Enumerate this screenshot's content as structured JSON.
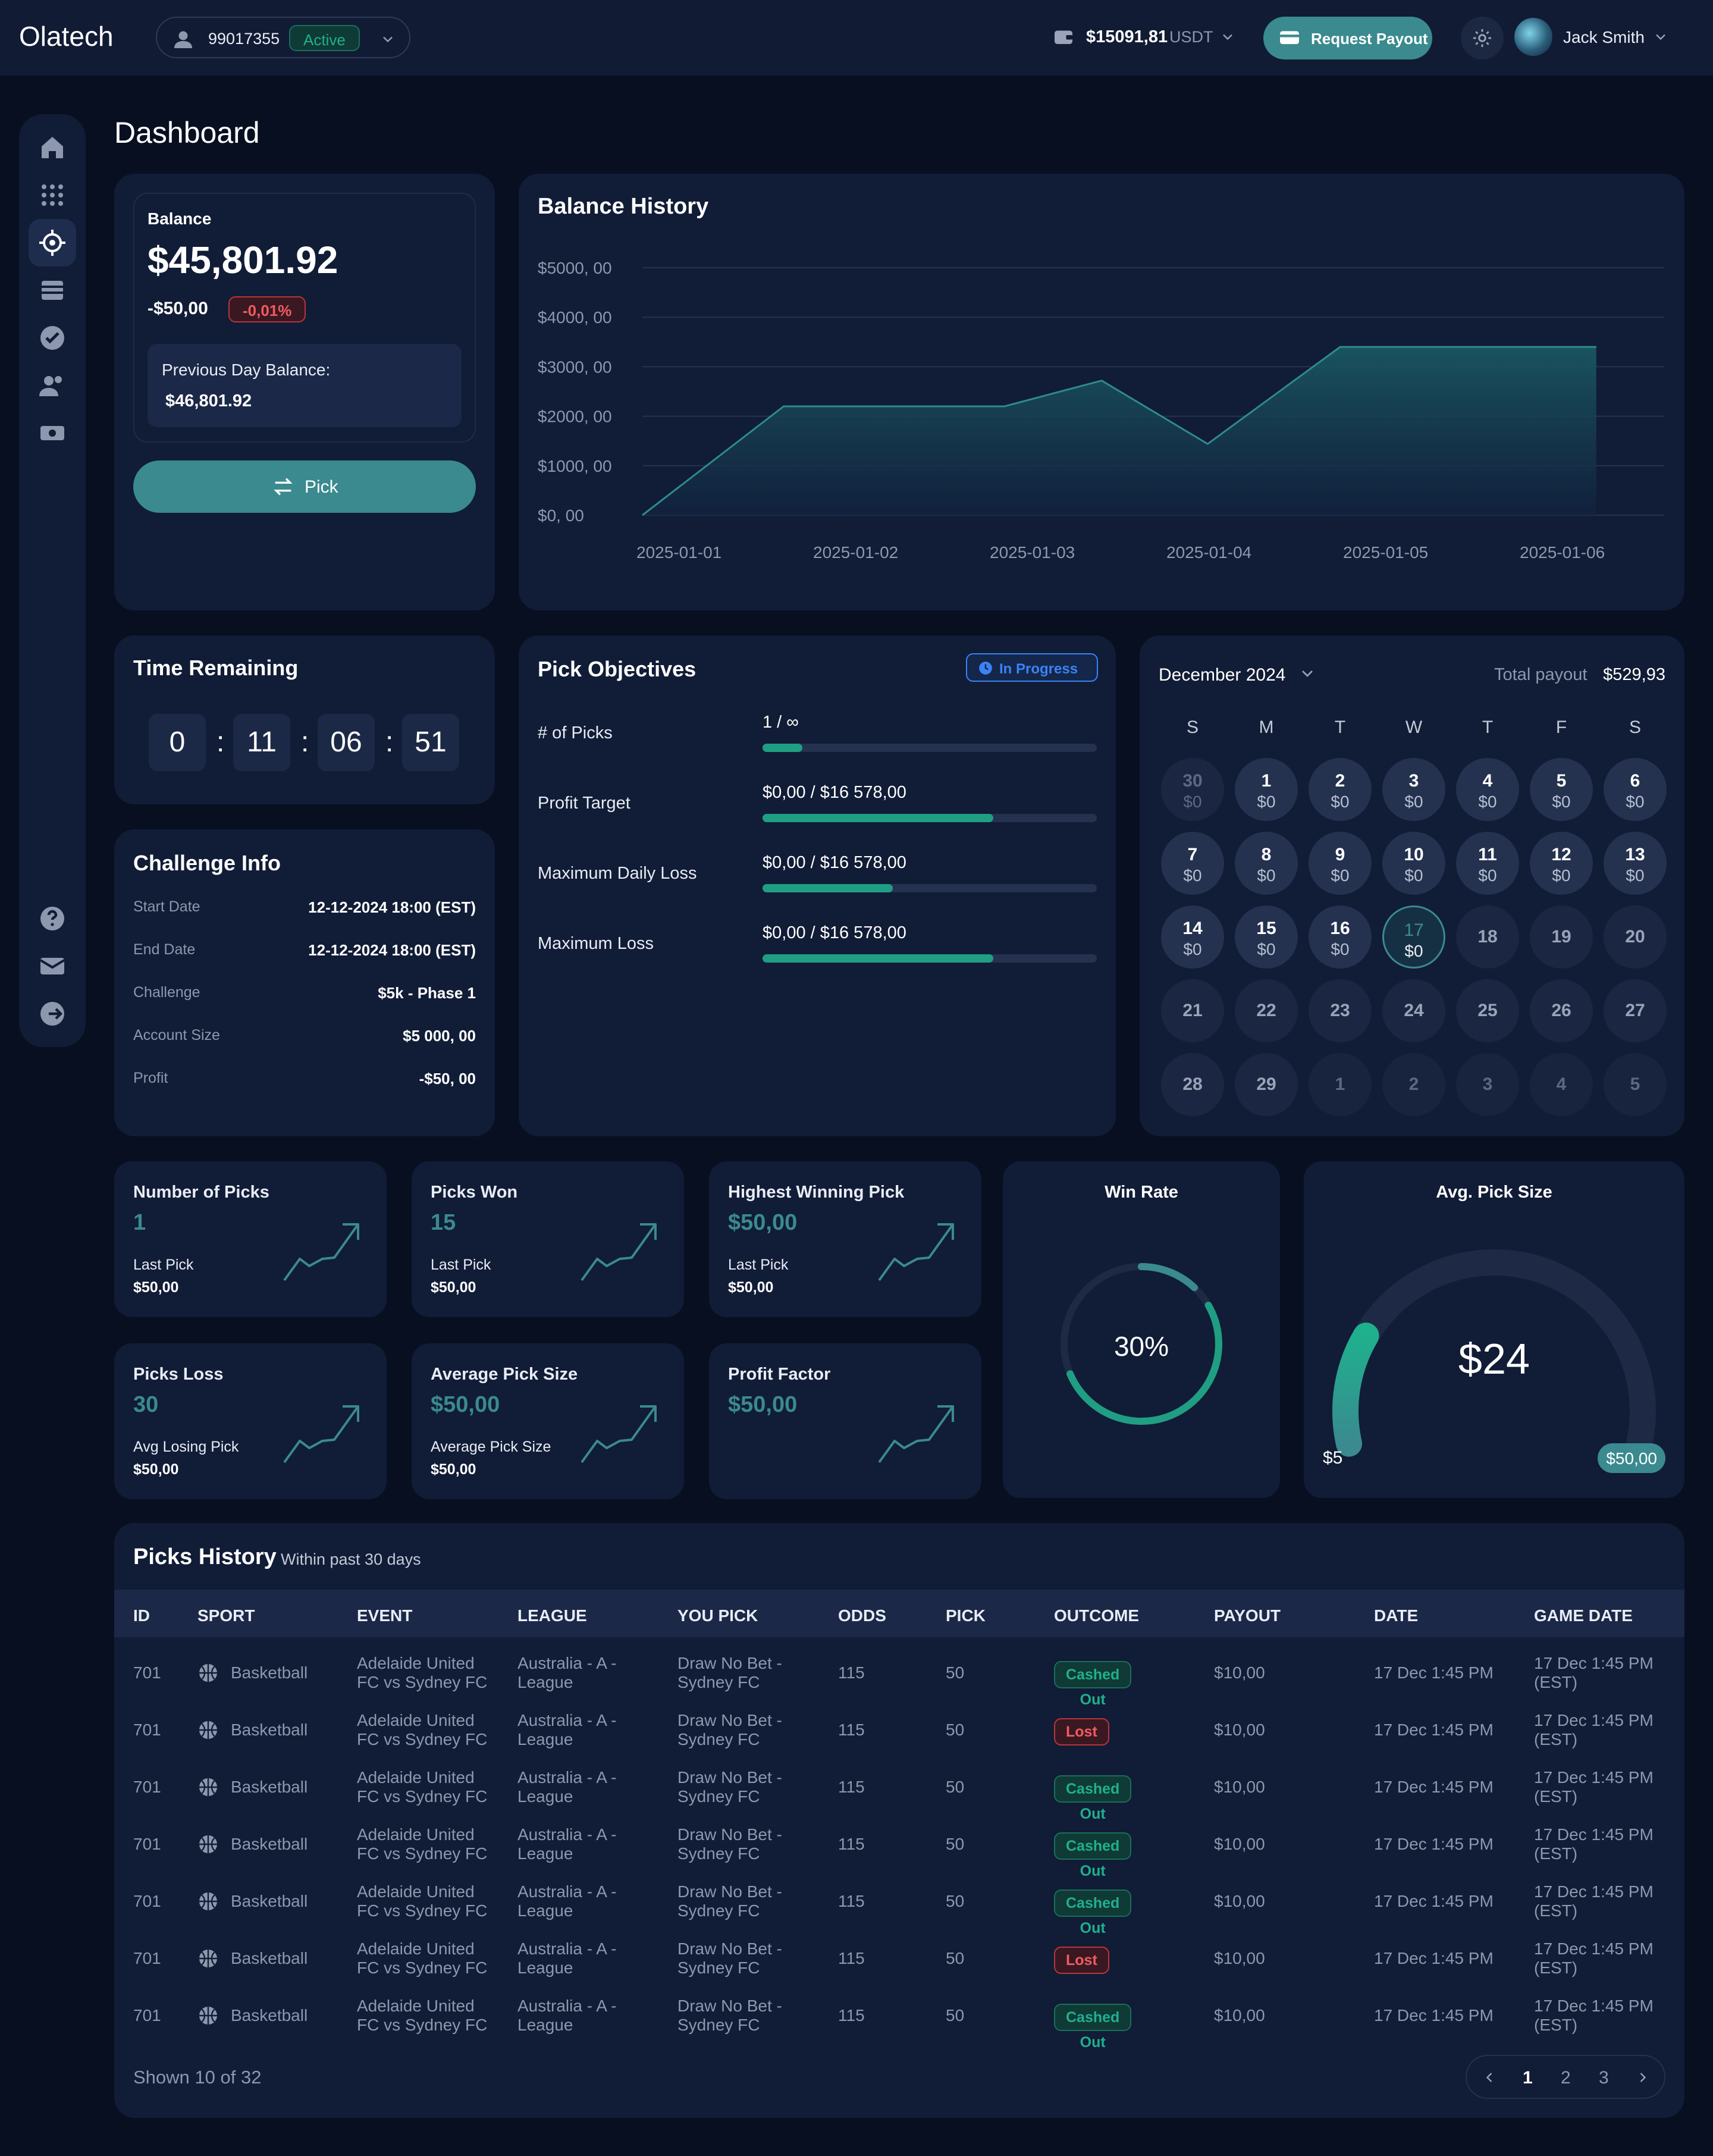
{
  "brand": "Olatech",
  "topbar": {
    "account_id": "99017355",
    "account_status": "Active",
    "wallet_amount": "$15091,81",
    "wallet_currency": "USDT",
    "request_payout": "Request Payout",
    "user_name": "Jack Smith"
  },
  "page_title": "Dashboard",
  "balance": {
    "label": "Balance",
    "amount": "$45,801.92",
    "change": "-$50,00",
    "change_pct": "-0,01%",
    "prev_label": "Previous Day Balance:",
    "prev_value": "$46,801.92",
    "pick_button": "Pick"
  },
  "balance_history": {
    "title": "Balance History"
  },
  "chart_data": {
    "type": "area",
    "title": "Balance History",
    "x": [
      "2025-01-01",
      "2025-01-02",
      "2025-01-03",
      "2025-01-04",
      "2025-01-05",
      "2025-01-06"
    ],
    "series": [
      {
        "points": [
          [
            0.0,
            0
          ],
          [
            0.8,
            2200
          ],
          [
            2.05,
            2200
          ],
          [
            2.6,
            2720
          ],
          [
            3.2,
            1440
          ],
          [
            3.95,
            3400
          ],
          [
            5.4,
            3400
          ]
        ]
      }
    ],
    "ylim": [
      0,
      5000
    ],
    "y_ticks": [
      "$0, 00",
      "$1000, 00",
      "$2000, 00",
      "$3000, 00",
      "$4000, 00",
      "$5000, 00"
    ],
    "x_ticks": [
      "2025-01-01",
      "2025-01-02",
      "2025-01-03",
      "2025-01-04",
      "2025-01-05",
      "2025-01-06"
    ],
    "grid": true,
    "fill_color": "#1a5762",
    "line_color": "#2e8a8e"
  },
  "time_remaining": {
    "title": "Time Remaining",
    "digits": [
      "0",
      "11",
      "06",
      "51"
    ],
    "sep": ":"
  },
  "challenge": {
    "title": "Challenge Info",
    "rows": [
      {
        "label": "Start Date",
        "value": "12-12-2024 18:00 (EST)"
      },
      {
        "label": "End Date",
        "value": "12-12-2024 18:00 (EST)"
      },
      {
        "label": "Challenge",
        "value": "$5k - Phase 1"
      },
      {
        "label": "Account Size",
        "value": "$5 000, 00"
      },
      {
        "label": "Profit",
        "value": "-$50, 00"
      }
    ]
  },
  "objectives": {
    "title": "Pick Objectives",
    "status": "In Progress",
    "rows": [
      {
        "label": "# of Picks",
        "value": "1  /  ∞",
        "progress": 0.12
      },
      {
        "label": "Profit Target",
        "value": "$0,00  /  $16 578,00",
        "progress": 0.69
      },
      {
        "label": "Maximum Daily Loss",
        "value": "$0,00  /  $16 578,00",
        "progress": 0.39
      },
      {
        "label": "Maximum Loss",
        "value": "$0,00  /  $16 578,00",
        "progress": 0.69
      }
    ]
  },
  "calendar": {
    "month": "December 2024",
    "total_label": "Total payout",
    "total_value": "$529,93",
    "weekdays": [
      "S",
      "M",
      "T",
      "W",
      "T",
      "F",
      "S"
    ],
    "cells": [
      {
        "d": "30",
        "v": "$0",
        "s": "prev"
      },
      {
        "d": "1",
        "v": "$0",
        "s": "pay"
      },
      {
        "d": "2",
        "v": "$0",
        "s": "pay"
      },
      {
        "d": "3",
        "v": "$0",
        "s": "pay"
      },
      {
        "d": "4",
        "v": "$0",
        "s": "pay"
      },
      {
        "d": "5",
        "v": "$0",
        "s": "pay"
      },
      {
        "d": "6",
        "v": "$0",
        "s": "pay"
      },
      {
        "d": "7",
        "v": "$0",
        "s": "pay"
      },
      {
        "d": "8",
        "v": "$0",
        "s": "pay"
      },
      {
        "d": "9",
        "v": "$0",
        "s": "pay"
      },
      {
        "d": "10",
        "v": "$0",
        "s": "pay"
      },
      {
        "d": "11",
        "v": "$0",
        "s": "pay"
      },
      {
        "d": "12",
        "v": "$0",
        "s": "pay"
      },
      {
        "d": "13",
        "v": "$0",
        "s": "pay"
      },
      {
        "d": "14",
        "v": "$0",
        "s": "pay"
      },
      {
        "d": "15",
        "v": "$0",
        "s": "pay"
      },
      {
        "d": "16",
        "v": "$0",
        "s": "pay"
      },
      {
        "d": "17",
        "v": "$0",
        "s": "today"
      },
      {
        "d": "18",
        "v": "",
        "s": "future"
      },
      {
        "d": "19",
        "v": "",
        "s": "future"
      },
      {
        "d": "20",
        "v": "",
        "s": "future"
      },
      {
        "d": "21",
        "v": "",
        "s": "future"
      },
      {
        "d": "22",
        "v": "",
        "s": "future"
      },
      {
        "d": "23",
        "v": "",
        "s": "future"
      },
      {
        "d": "24",
        "v": "",
        "s": "future"
      },
      {
        "d": "25",
        "v": "",
        "s": "future"
      },
      {
        "d": "26",
        "v": "",
        "s": "future"
      },
      {
        "d": "27",
        "v": "",
        "s": "future"
      },
      {
        "d": "28",
        "v": "",
        "s": "future"
      },
      {
        "d": "29",
        "v": "",
        "s": "future"
      },
      {
        "d": "1",
        "v": "",
        "s": "next"
      },
      {
        "d": "2",
        "v": "",
        "s": "next"
      },
      {
        "d": "3",
        "v": "",
        "s": "next"
      },
      {
        "d": "4",
        "v": "",
        "s": "next"
      },
      {
        "d": "5",
        "v": "",
        "s": "next"
      }
    ]
  },
  "stats": [
    {
      "title": "Number of Picks",
      "value": "1",
      "sub_label": "Last Pick",
      "sub_value": "$50,00"
    },
    {
      "title": "Picks Won",
      "value": "15",
      "sub_label": "Last Pick",
      "sub_value": "$50,00"
    },
    {
      "title": "Highest Winning Pick",
      "value": "$50,00",
      "sub_label": "Last Pick",
      "sub_value": "$50,00"
    },
    {
      "title": "Picks Loss",
      "value": "30",
      "sub_label": "Avg Losing Pick",
      "sub_value": "$50,00"
    },
    {
      "title": "Average Pick Size",
      "value": "$50,00",
      "sub_label": "Average Pick Size",
      "sub_value": "$50,00"
    },
    {
      "title": "Profit Factor",
      "value": "$50,00",
      "sub_label": "",
      "sub_value": ""
    }
  ],
  "win_rate": {
    "title": "Win Rate",
    "value": "30%",
    "fraction": 0.3
  },
  "avg_pick": {
    "title": "Avg. Pick Size",
    "value": "$24",
    "min_label": "$5",
    "max_label": "$50,00",
    "fraction": 0.21
  },
  "history": {
    "title": "Picks History",
    "subtitle": "Within past 30 days",
    "columns": [
      "ID",
      "SPORT",
      "EVENT",
      "LEAGUE",
      "YOU PICK",
      "ODDS",
      "PICK",
      "OUTCOME",
      "PAYOUT",
      "DATE",
      "GAME DATE"
    ],
    "rows": [
      {
        "id": "701",
        "sport": "Basketball",
        "event1": "Adelaide United",
        "event2": "FC vs Sydney FC",
        "league1": "Australia - A -",
        "league2": "League",
        "pick1": "Draw No Bet -",
        "pick2": "Sydney FC",
        "odds": "115",
        "pick": "50",
        "outcome": "Cashed Out",
        "payout": "$10,00",
        "date": "17 Dec 1:45 PM",
        "game1": "17 Dec 1:45 PM",
        "game2": "(EST)"
      },
      {
        "id": "701",
        "sport": "Basketball",
        "event1": "Adelaide United",
        "event2": "FC vs Sydney FC",
        "league1": "Australia - A -",
        "league2": "League",
        "pick1": "Draw No Bet -",
        "pick2": "Sydney FC",
        "odds": "115",
        "pick": "50",
        "outcome": "Lost",
        "payout": "$10,00",
        "date": "17 Dec 1:45 PM",
        "game1": "17 Dec 1:45 PM",
        "game2": "(EST)"
      },
      {
        "id": "701",
        "sport": "Basketball",
        "event1": "Adelaide United",
        "event2": "FC vs Sydney FC",
        "league1": "Australia - A -",
        "league2": "League",
        "pick1": "Draw No Bet -",
        "pick2": "Sydney FC",
        "odds": "115",
        "pick": "50",
        "outcome": "Cashed Out",
        "payout": "$10,00",
        "date": "17 Dec 1:45 PM",
        "game1": "17 Dec 1:45 PM",
        "game2": "(EST)"
      },
      {
        "id": "701",
        "sport": "Basketball",
        "event1": "Adelaide United",
        "event2": "FC vs Sydney FC",
        "league1": "Australia - A -",
        "league2": "League",
        "pick1": "Draw No Bet -",
        "pick2": "Sydney FC",
        "odds": "115",
        "pick": "50",
        "outcome": "Cashed Out",
        "payout": "$10,00",
        "date": "17 Dec 1:45 PM",
        "game1": "17 Dec 1:45 PM",
        "game2": "(EST)"
      },
      {
        "id": "701",
        "sport": "Basketball",
        "event1": "Adelaide United",
        "event2": "FC vs Sydney FC",
        "league1": "Australia - A -",
        "league2": "League",
        "pick1": "Draw No Bet -",
        "pick2": "Sydney FC",
        "odds": "115",
        "pick": "50",
        "outcome": "Cashed Out",
        "payout": "$10,00",
        "date": "17 Dec 1:45 PM",
        "game1": "17 Dec 1:45 PM",
        "game2": "(EST)"
      },
      {
        "id": "701",
        "sport": "Basketball",
        "event1": "Adelaide United",
        "event2": "FC vs Sydney FC",
        "league1": "Australia - A -",
        "league2": "League",
        "pick1": "Draw No Bet -",
        "pick2": "Sydney FC",
        "odds": "115",
        "pick": "50",
        "outcome": "Lost",
        "payout": "$10,00",
        "date": "17 Dec 1:45 PM",
        "game1": "17 Dec 1:45 PM",
        "game2": "(EST)"
      },
      {
        "id": "701",
        "sport": "Basketball",
        "event1": "Adelaide United",
        "event2": "FC vs Sydney FC",
        "league1": "Australia - A -",
        "league2": "League",
        "pick1": "Draw No Bet -",
        "pick2": "Sydney FC",
        "odds": "115",
        "pick": "50",
        "outcome": "Cashed Out",
        "payout": "$10,00",
        "date": "17 Dec 1:45 PM",
        "game1": "17 Dec 1:45 PM",
        "game2": "(EST)"
      }
    ],
    "shown": "Shown 10 of 32",
    "pages": [
      "1",
      "2",
      "3"
    ]
  },
  "colors": {
    "accent": "#3a8a8f",
    "positive": "#1fb08d",
    "negative": "#e5484d",
    "info": "#3b82f6"
  },
  "icons": {
    "sidebar": [
      "home-icon",
      "grid-icon",
      "target-icon",
      "list-icon",
      "check-circle-icon",
      "users-icon",
      "ticket-icon"
    ],
    "sidebar_bottom": [
      "help-icon",
      "mail-icon",
      "logout-icon"
    ]
  }
}
